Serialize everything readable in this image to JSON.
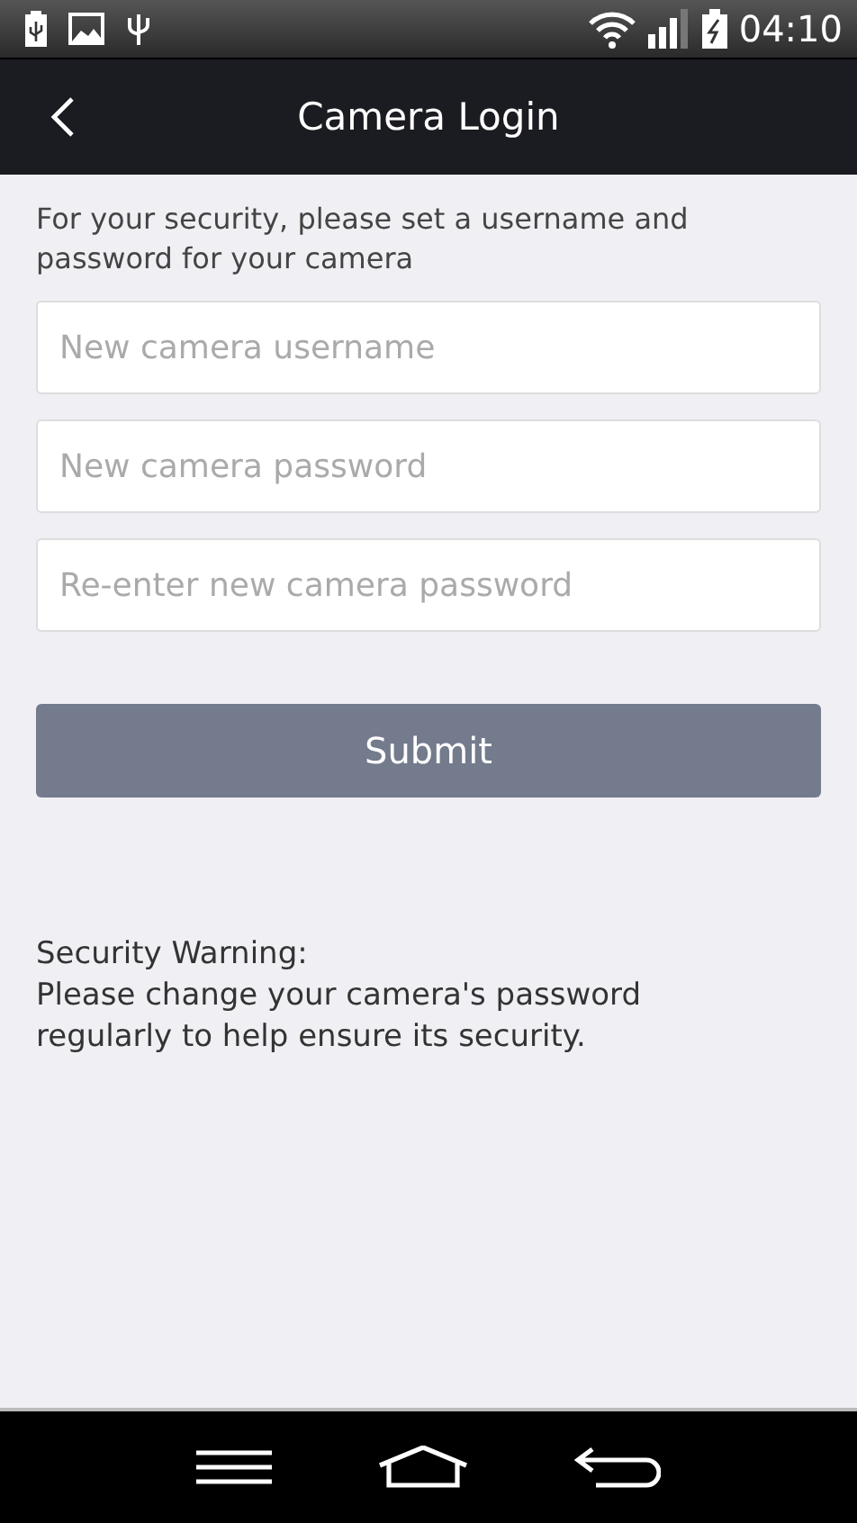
{
  "status_bar": {
    "time": "04:10"
  },
  "header": {
    "title": "Camera Login"
  },
  "intro": "For your security, please set a username and password for your camera",
  "fields": [
    {
      "placeholder": "New camera username"
    },
    {
      "placeholder": "New camera password"
    },
    {
      "placeholder": "Re-enter new camera password"
    }
  ],
  "submit_button": {
    "label": "Submit",
    "disabled": true
  },
  "warning": {
    "title": "Security Warning:",
    "text": "Please change your camera's password regularly to help ensure its security."
  }
}
